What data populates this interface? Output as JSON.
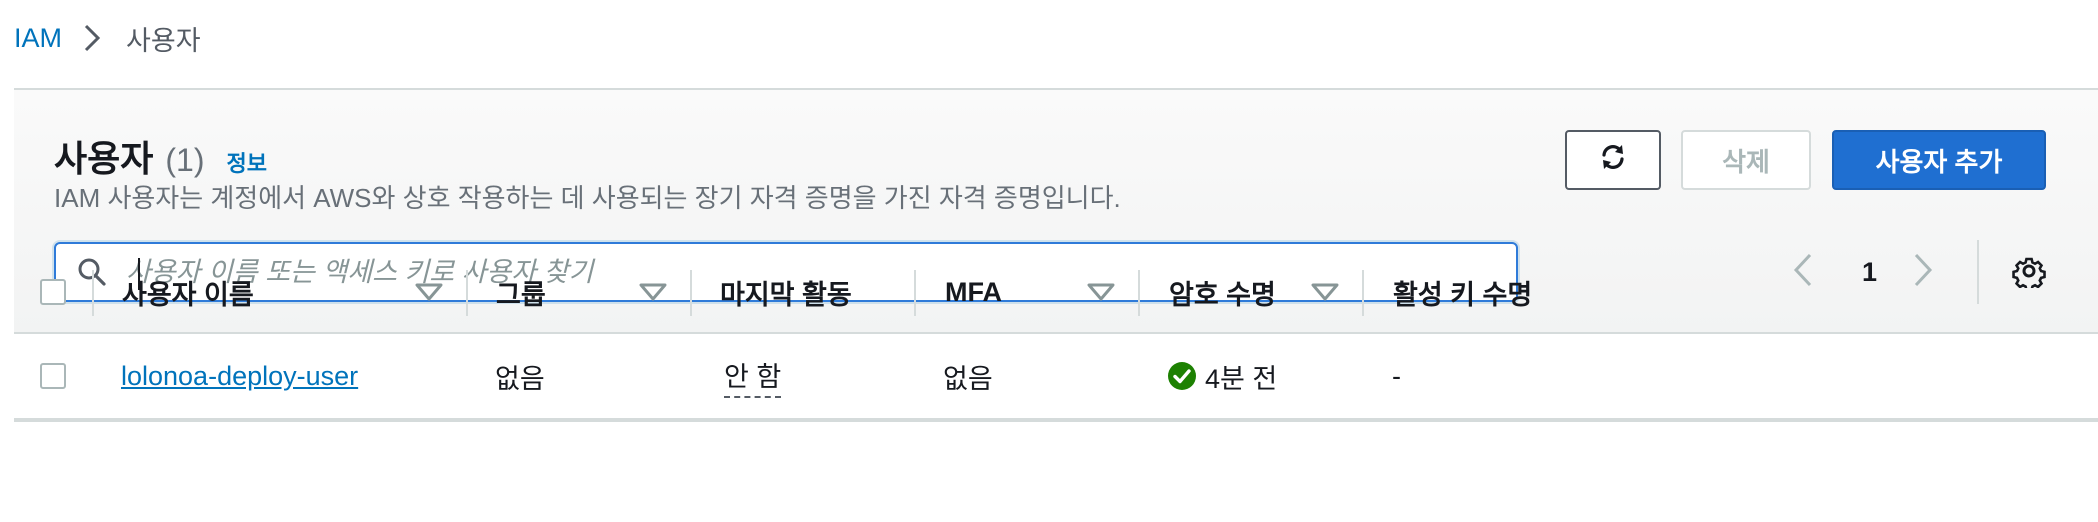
{
  "breadcrumb": {
    "root": "IAM",
    "current": "사용자"
  },
  "header": {
    "title": "사용자",
    "count": "(1)",
    "info": "정보",
    "description": "IAM 사용자는 계정에서 AWS와 상호 작용하는 데 사용되는 장기 자격 증명을 가진 자격 증명입니다."
  },
  "actions": {
    "refresh_icon": "refresh-icon",
    "delete_label": "삭제",
    "add_label": "사용자 추가"
  },
  "search": {
    "placeholder": "사용자 이름 또는 액세스 키로 사용자 찾기",
    "value": ""
  },
  "pagination": {
    "page": "1"
  },
  "table": {
    "columns": [
      "사용자 이름",
      "그룹",
      "마지막 활동",
      "MFA",
      "암호 수명",
      "활성 키 수명"
    ],
    "rows": [
      {
        "username": "lolonoa-deploy-user",
        "group": "없음",
        "last_activity": "안 함",
        "mfa": "없음",
        "password_age": "4분 전",
        "active_key_age": "-"
      }
    ]
  },
  "colors": {
    "link": "#0073bb",
    "primary_button": "#1f6fd1",
    "success": "#1d8102",
    "border": "#d5dbdb",
    "muted_text": "#687078"
  }
}
